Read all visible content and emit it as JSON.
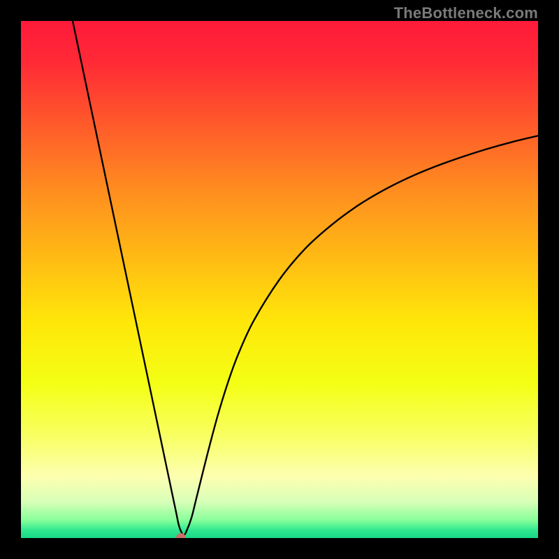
{
  "watermark": {
    "text": "TheBottleneck.com"
  },
  "chart_data": {
    "type": "line",
    "title": "",
    "xlabel": "",
    "ylabel": "",
    "xlim": [
      0,
      100
    ],
    "ylim": [
      0,
      100
    ],
    "grid": false,
    "legend": false,
    "background": "rainbow-vertical-gradient",
    "series": [
      {
        "name": "bottleneck-curve",
        "color": "#000000",
        "x": [
          10,
          12,
          14,
          16,
          18,
          20,
          22,
          24,
          26,
          28,
          29,
          30,
          30.5,
          31,
          31.5,
          32,
          33,
          34,
          36,
          38,
          40,
          42,
          45,
          50,
          55,
          60,
          65,
          70,
          75,
          80,
          85,
          90,
          95,
          100
        ],
        "y": [
          100,
          90.5,
          81,
          71.5,
          62,
          52.5,
          43,
          33.5,
          24,
          14.5,
          9.75,
          5,
          2.6,
          1.2,
          0.6,
          1.3,
          4,
          8,
          16,
          23.5,
          30,
          35.5,
          42,
          50,
          56,
          60.5,
          64.2,
          67.2,
          69.7,
          71.8,
          73.6,
          75.2,
          76.6,
          77.8
        ]
      }
    ],
    "marker": {
      "name": "bottleneck-point",
      "x": 31,
      "y": 0,
      "color": "#c97067"
    },
    "gradient_stops": [
      {
        "offset": 0.0,
        "color": "#ff1a3a"
      },
      {
        "offset": 0.08,
        "color": "#ff2a36"
      },
      {
        "offset": 0.2,
        "color": "#ff5a2a"
      },
      {
        "offset": 0.32,
        "color": "#ff8a20"
      },
      {
        "offset": 0.45,
        "color": "#ffb814"
      },
      {
        "offset": 0.58,
        "color": "#ffe60a"
      },
      {
        "offset": 0.7,
        "color": "#f4ff14"
      },
      {
        "offset": 0.8,
        "color": "#f8ff60"
      },
      {
        "offset": 0.88,
        "color": "#fdffb0"
      },
      {
        "offset": 0.93,
        "color": "#d8ffb8"
      },
      {
        "offset": 0.965,
        "color": "#88ff9a"
      },
      {
        "offset": 0.985,
        "color": "#30e890"
      },
      {
        "offset": 1.0,
        "color": "#18d888"
      }
    ]
  }
}
